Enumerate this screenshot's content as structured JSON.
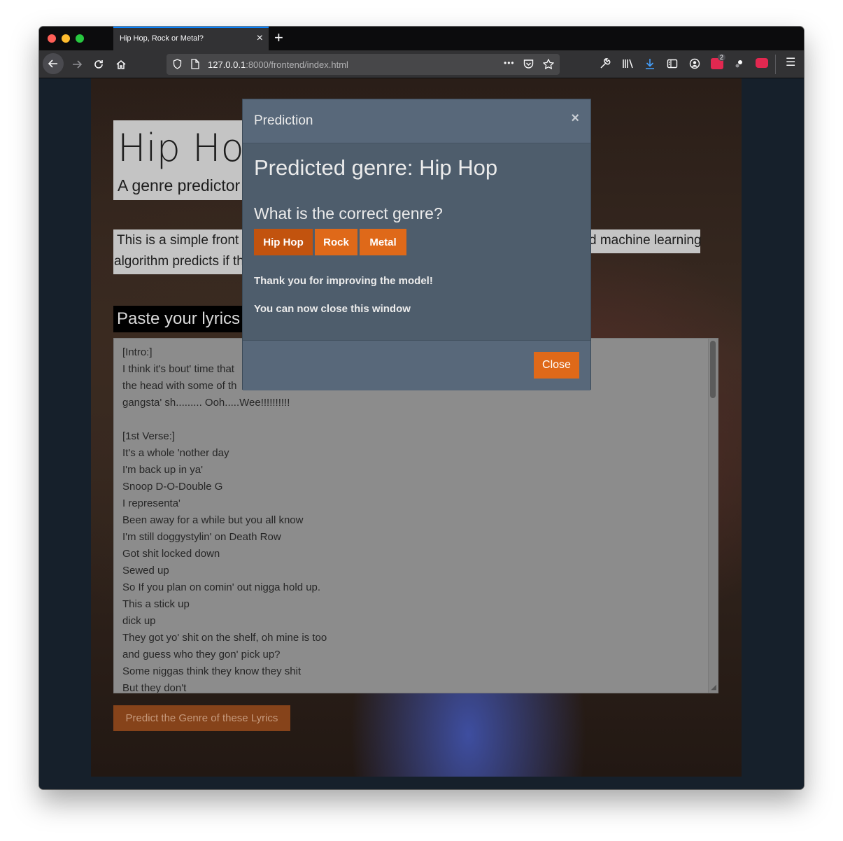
{
  "browser": {
    "tab_title": "Hip Hop, Rock or Metal?",
    "tab_close": "×",
    "new_tab": "+",
    "url_host": "127.0.0.1",
    "url_rest": ":8000/frontend/index.html",
    "menu_glyph": "☰",
    "more_glyph": "•••",
    "ext_badge_count": "2"
  },
  "page": {
    "hero_title": "Hip Hop",
    "hero_subtitle": "A genre predictor",
    "intro_line1_left": "This is a simple front",
    "intro_line2_left": "algorithm predicts if th",
    "intro_line1_right": "d machine learning",
    "paste_heading": "Paste your lyrics",
    "lyrics": "[Intro:]\nI think it's bout' time that\nthe head with some of th\ngangsta' sh......... Ooh.....Wee!!!!!!!!!!\n\n[1st Verse:]\nIt's a whole 'nother day\nI'm back up in ya'\nSnoop D-O-Double G\nI representa'\nBeen away for a while but you all know\nI'm still doggystylin' on Death Row\nGot shit locked down\nSewed up\nSo If you plan on comin' out nigga hold up.\nThis a stick up\ndick up\nThey got yo' shit on the shelf, oh mine is too\nand guess who they gon' pick up?\nSome niggas think they know they shit\nBut they don't",
    "predict_button": "Predict the Genre of these Lyrics"
  },
  "modal": {
    "title": "Prediction",
    "close_x": "×",
    "prediction_heading": "Predicted genre: Hip Hop",
    "question": "What is the correct genre?",
    "genres": [
      "Hip Hop",
      "Rock",
      "Metal"
    ],
    "thanks": "Thank you for improving the model!",
    "close_note": "You can now close this window",
    "close_button": "Close"
  },
  "colors": {
    "accent": "#df6919",
    "accent_active": "#c2530e",
    "modal_bg": "#4e5d6c",
    "modal_header": "#58687a"
  }
}
